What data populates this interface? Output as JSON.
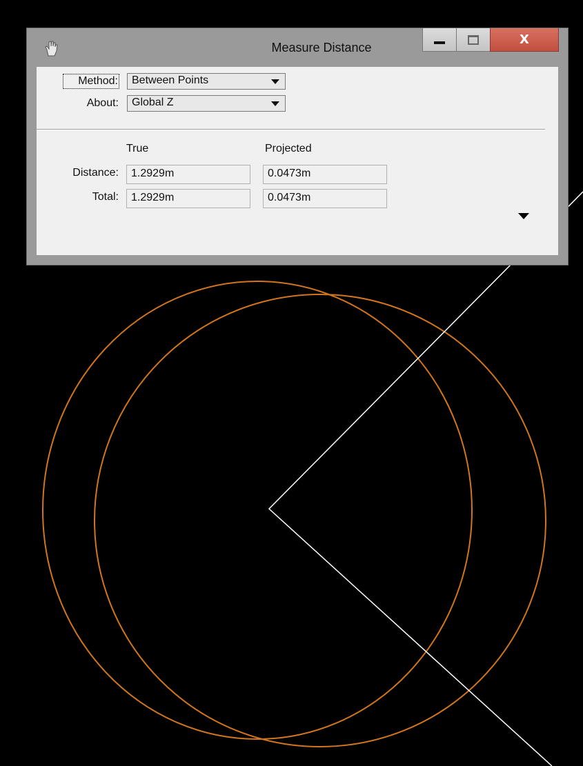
{
  "window": {
    "title": "Measure Distance",
    "close_label": "X"
  },
  "form": {
    "method": {
      "label": "Method:",
      "value": "Between Points"
    },
    "about": {
      "label": "About:",
      "value": "Global Z"
    },
    "columns": {
      "true": "True",
      "projected": "Projected"
    },
    "distance": {
      "label": "Distance:",
      "true": "1.2929m",
      "projected": "0.0473m"
    },
    "total": {
      "label": "Total:",
      "true": "1.2929m",
      "projected": "0.0473m"
    }
  },
  "icons": {
    "app": "hand-pointer-icon",
    "minimize": "minimize-icon",
    "maximize": "maximize-icon",
    "close": "close-icon",
    "expand": "expand-triangle-icon"
  },
  "colors": {
    "canvas_background": "#000000",
    "circle_stroke": "#d2761e",
    "line_stroke": "#ffffff",
    "close_button": "#c75446"
  }
}
